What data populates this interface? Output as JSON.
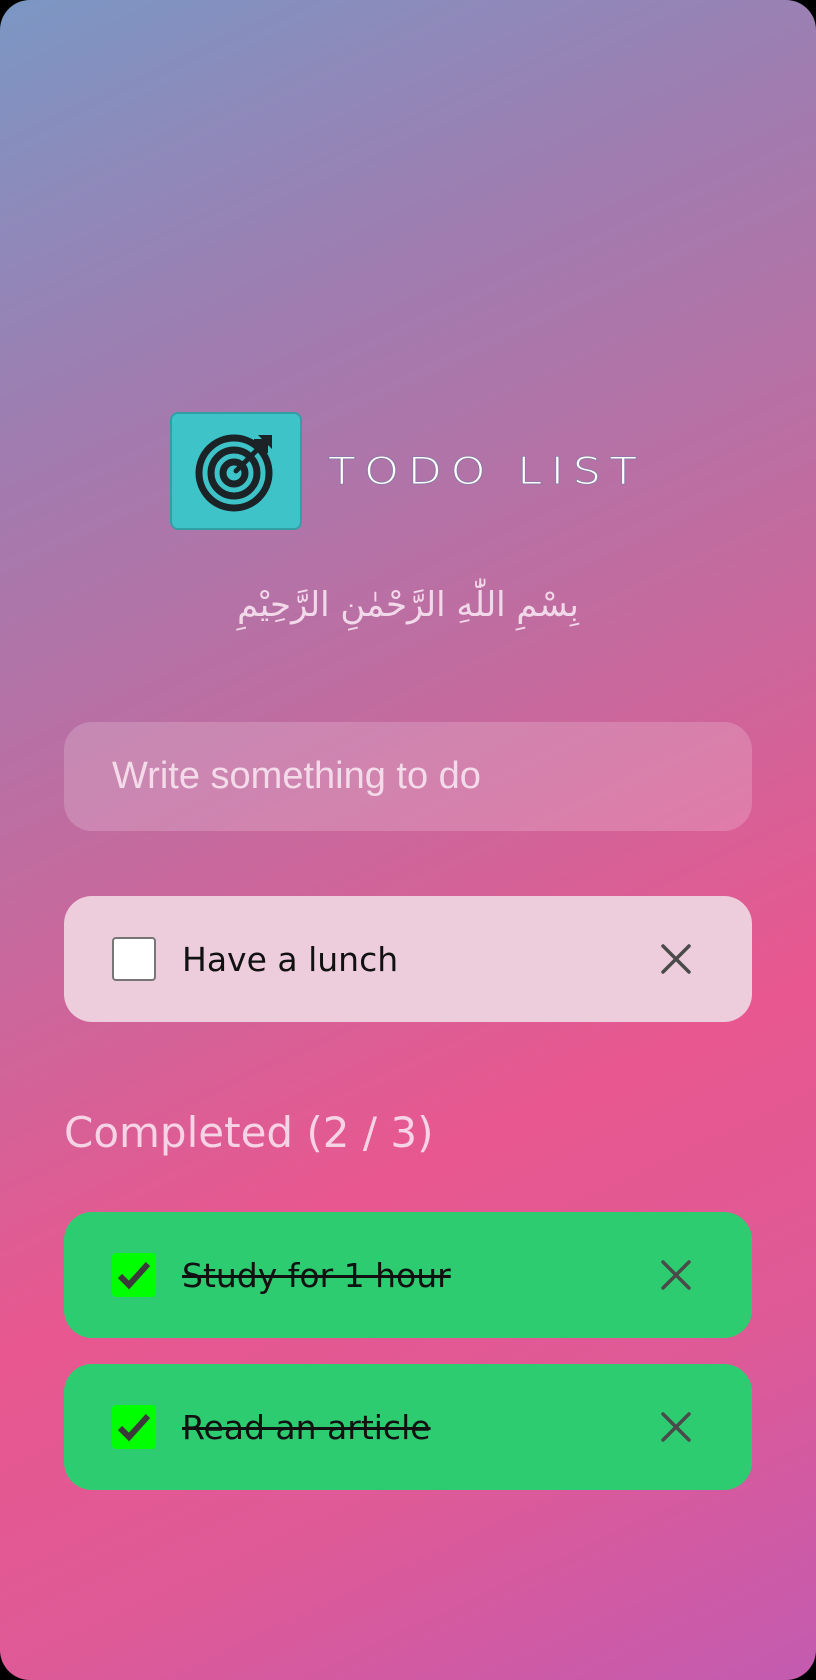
{
  "header": {
    "title": "TODO LIST",
    "logo_icon": "target-icon",
    "subtitle": "بِسْمِ اللّٰهِ الرَّحْمٰنِ الرَّحِيْمِ"
  },
  "input": {
    "placeholder": "Write something to do",
    "value": ""
  },
  "pending_items": [
    {
      "label": "Have a lunch",
      "checked": false
    }
  ],
  "completed": {
    "heading": "Completed (2 / 3)",
    "items": [
      {
        "label": "Study for 1 hour",
        "checked": true
      },
      {
        "label": "Read an article",
        "checked": true
      }
    ]
  },
  "icons": {
    "delete": "close-icon",
    "check": "checkmark-icon"
  },
  "colors": {
    "logo_bg": "#3ec3c9",
    "pending_bg": "#edcddc",
    "completed_bg": "#2ecc71",
    "check_bg": "#00ff00"
  }
}
